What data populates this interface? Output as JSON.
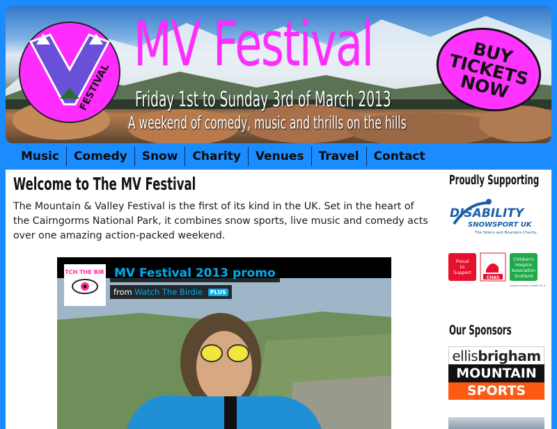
{
  "header": {
    "title": "MV Festival",
    "dates": "Friday 1st to Sunday 3rd of March 2013",
    "tagline": "A weekend of comedy, music and thrills on the hills",
    "buy_button": "BUY TICKETS NOW",
    "logo_text": "FESTIVAL"
  },
  "nav": {
    "items": [
      {
        "label": "Music"
      },
      {
        "label": "Comedy"
      },
      {
        "label": "Snow"
      },
      {
        "label": "Charity"
      },
      {
        "label": "Venues"
      },
      {
        "label": "Travel"
      },
      {
        "label": "Contact"
      }
    ]
  },
  "main": {
    "heading": "Welcome to The MV Festival",
    "intro": "The Mountain & Valley Festival is the first of its kind in the UK. Set in the heart of the Cairngorms National Park, it combines snow sports, live music and comedy acts over one amazing action-packed weekend.",
    "video": {
      "title": "MV Festival 2013 promo",
      "from_label": "from",
      "author": "Watch The Birdie",
      "badge": "PLUS",
      "thumb_text": "WATCH THE BIRDIE"
    }
  },
  "sidebar": {
    "supporting_heading": "Proudly Supporting",
    "disability_logo_text": "DISABILITY SNOWSPORT UK",
    "disability_logo_sub": "The Skiers and Boarders Charity",
    "charity_badge": "Proud to Support",
    "chas_text": "CHAS",
    "chas_org": "Children's Hospice Association Scotland",
    "sponsors_heading": "Our Sponsors",
    "sponsor": {
      "line1_a": "ellis",
      "line1_b": "brigham",
      "line2": "MOUNTAIN",
      "line3": "SPORTS"
    }
  },
  "colors": {
    "page_bg": "#1a8cff",
    "title_magenta": "#ff2cff",
    "video_link": "#00adef",
    "sponsor_orange": "#ff5a14"
  }
}
